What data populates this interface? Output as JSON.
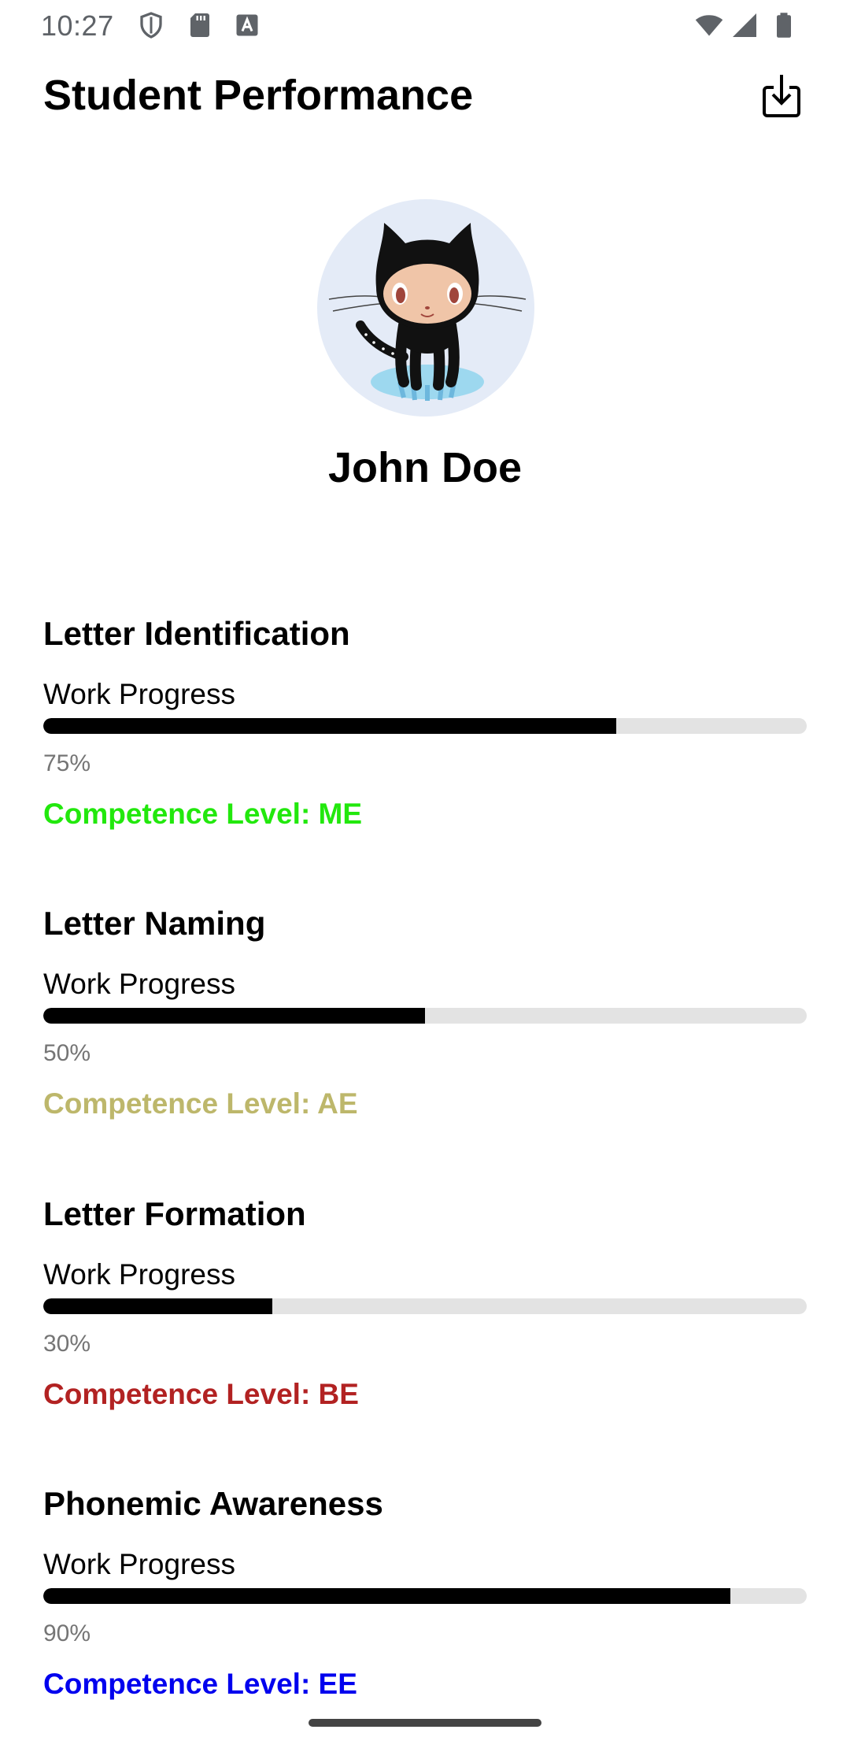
{
  "status_bar": {
    "time": "10:27",
    "left_icons": [
      "shield-icon",
      "sd-card-icon",
      "font-icon"
    ],
    "right_icons": [
      "wifi-icon",
      "cell-signal-icon",
      "battery-icon"
    ]
  },
  "app_bar": {
    "title": "Student Performance",
    "action_icon": "download-icon"
  },
  "profile": {
    "avatar_icon": "octocat-avatar",
    "name": "John Doe"
  },
  "skills": [
    {
      "title": "Letter Identification",
      "progress_label": "Work Progress",
      "progress": 0.75,
      "progress_text": "75%",
      "competence": "Competence Level: ME",
      "competence_color": "#22e80d"
    },
    {
      "title": "Letter Naming",
      "progress_label": "Work Progress",
      "progress": 0.5,
      "progress_text": "50%",
      "competence": "Competence Level: AE",
      "competence_color": "#bdb76b"
    },
    {
      "title": "Letter Formation",
      "progress_label": "Work Progress",
      "progress": 0.3,
      "progress_text": "30%",
      "competence": "Competence Level: BE",
      "competence_color": "#b22222"
    },
    {
      "title": "Phonemic Awareness",
      "progress_label": "Work Progress",
      "progress": 0.9,
      "progress_text": "90%",
      "competence": "Competence Level: EE",
      "competence_color": "#0000ee"
    }
  ]
}
